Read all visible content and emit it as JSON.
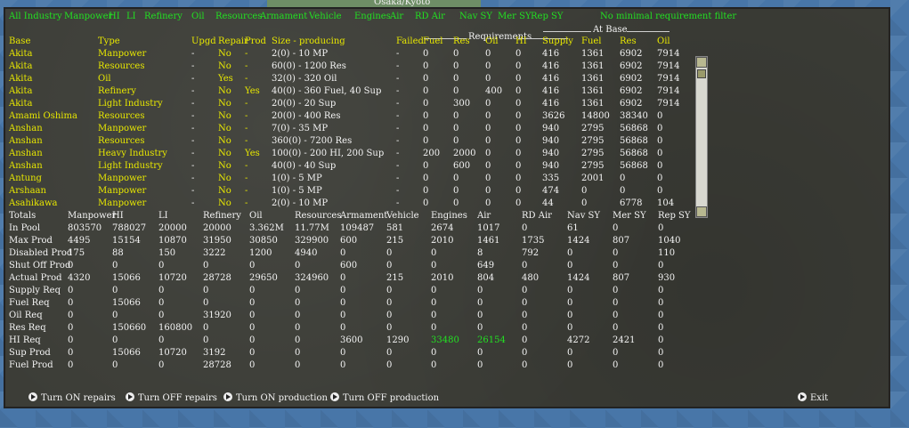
{
  "map": {
    "city": "Osaka/Kyoto"
  },
  "filters": [
    "All Industry",
    "Manpower",
    "HI",
    "LI",
    "Refinery",
    "Oil",
    "Resources",
    "Armament",
    "Vehicle",
    "Engines",
    "Air",
    "RD Air",
    "Nav SY",
    "Mer SY",
    "Rep SY",
    "No minimal requirement filter"
  ],
  "sections": {
    "requirements": "Requirements",
    "at_base": "At Base"
  },
  "columns": [
    "Base",
    "Type",
    "Upgd",
    "Repair",
    "Prod",
    "Size - producing",
    "Failed",
    "Fuel",
    "Res",
    "Oil",
    "HI",
    "Supply",
    "Fuel",
    "Res",
    "Oil"
  ],
  "bases": [
    [
      "Akita",
      "Manpower",
      "-",
      "No",
      "-",
      "2(0) - 10 MP",
      "-",
      "0",
      "0",
      "0",
      "0",
      "416",
      "1361",
      "6902",
      "7914"
    ],
    [
      "Akita",
      "Resources",
      "-",
      "No",
      "-",
      "60(0) - 1200 Res",
      "-",
      "0",
      "0",
      "0",
      "0",
      "416",
      "1361",
      "6902",
      "7914"
    ],
    [
      "Akita",
      "Oil",
      "-",
      "Yes",
      "-",
      "32(0) - 320 Oil",
      "-",
      "0",
      "0",
      "0",
      "0",
      "416",
      "1361",
      "6902",
      "7914"
    ],
    [
      "Akita",
      "Refinery",
      "-",
      "No",
      "Yes",
      "40(0) - 360 Fuel, 40 Sup",
      "-",
      "0",
      "0",
      "400",
      "0",
      "416",
      "1361",
      "6902",
      "7914"
    ],
    [
      "Akita",
      "Light Industry",
      "-",
      "No",
      "-",
      "20(0) - 20 Sup",
      "-",
      "0",
      "300",
      "0",
      "0",
      "416",
      "1361",
      "6902",
      "7914"
    ],
    [
      "Amami Oshima",
      "Resources",
      "-",
      "No",
      "-",
      "20(0) - 400 Res",
      "-",
      "0",
      "0",
      "0",
      "0",
      "3626",
      "14800",
      "38340",
      "0"
    ],
    [
      "Anshan",
      "Manpower",
      "-",
      "No",
      "-",
      "7(0) - 35 MP",
      "-",
      "0",
      "0",
      "0",
      "0",
      "940",
      "2795",
      "56868",
      "0"
    ],
    [
      "Anshan",
      "Resources",
      "-",
      "No",
      "-",
      "360(0) - 7200 Res",
      "-",
      "0",
      "0",
      "0",
      "0",
      "940",
      "2795",
      "56868",
      "0"
    ],
    [
      "Anshan",
      "Heavy Industry",
      "-",
      "No",
      "Yes",
      "100(0) - 200 HI, 200 Sup",
      "-",
      "200",
      "2000",
      "0",
      "0",
      "940",
      "2795",
      "56868",
      "0"
    ],
    [
      "Anshan",
      "Light Industry",
      "-",
      "No",
      "-",
      "40(0) - 40 Sup",
      "-",
      "0",
      "600",
      "0",
      "0",
      "940",
      "2795",
      "56868",
      "0"
    ],
    [
      "Antung",
      "Manpower",
      "-",
      "No",
      "-",
      "1(0) - 5 MP",
      "-",
      "0",
      "0",
      "0",
      "0",
      "335",
      "2001",
      "0",
      "0"
    ],
    [
      "Arshaan",
      "Manpower",
      "-",
      "No",
      "-",
      "1(0) - 5 MP",
      "-",
      "0",
      "0",
      "0",
      "0",
      "474",
      "0",
      "0",
      "0"
    ],
    [
      "Asahikawa",
      "Manpower",
      "-",
      "No",
      "-",
      "2(0) - 10 MP",
      "-",
      "0",
      "0",
      "0",
      "0",
      "44",
      "0",
      "6778",
      "104"
    ]
  ],
  "totals_header": [
    "Totals",
    "Manpower",
    "HI",
    "LI",
    "Refinery",
    "Oil",
    "Resources",
    "Armament",
    "Vehicle",
    "Engines",
    "Air",
    "RD Air",
    "Nav SY",
    "Mer SY",
    "Rep SY"
  ],
  "totals": [
    [
      "In Pool",
      "803570",
      "788027",
      "20000",
      "20000",
      "3.362M",
      "11.77M",
      "109487",
      "581",
      "2674",
      "1017",
      "0",
      "61",
      "0",
      "0"
    ],
    [
      "Max Prod",
      "4495",
      "15154",
      "10870",
      "31950",
      "30850",
      "329900",
      "600",
      "215",
      "2010",
      "1461",
      "1735",
      "1424",
      "807",
      "1040"
    ],
    [
      "Disabled Prod",
      "175",
      "88",
      "150",
      "3222",
      "1200",
      "4940",
      "0",
      "0",
      "0",
      "8",
      "792",
      "0",
      "0",
      "110"
    ],
    [
      "Shut Off Prod",
      "0",
      "0",
      "0",
      "0",
      "0",
      "0",
      "600",
      "0",
      "0",
      "649",
      "0",
      "0",
      "0",
      "0"
    ],
    [
      "Actual Prod",
      "4320",
      "15066",
      "10720",
      "28728",
      "29650",
      "324960",
      "0",
      "215",
      "2010",
      "804",
      "480",
      "1424",
      "807",
      "930"
    ],
    [
      "Supply Req",
      "0",
      "0",
      "0",
      "0",
      "0",
      "0",
      "0",
      "0",
      "0",
      "0",
      "0",
      "0",
      "0",
      "0"
    ],
    [
      "Fuel Req",
      "0",
      "15066",
      "0",
      "0",
      "0",
      "0",
      "0",
      "0",
      "0",
      "0",
      "0",
      "0",
      "0",
      "0"
    ],
    [
      "Oil Req",
      "0",
      "0",
      "0",
      "31920",
      "0",
      "0",
      "0",
      "0",
      "0",
      "0",
      "0",
      "0",
      "0",
      "0"
    ],
    [
      "Res Req",
      "0",
      "150660",
      "160800",
      "0",
      "0",
      "0",
      "0",
      "0",
      "0",
      "0",
      "0",
      "0",
      "0",
      "0"
    ],
    [
      "HI Req",
      "0",
      "0",
      "0",
      "0",
      "0",
      "0",
      "3600",
      "1290",
      "33480",
      "26154",
      "0",
      "4272",
      "2421",
      "0"
    ],
    [
      "Sup Prod",
      "0",
      "15066",
      "10720",
      "3192",
      "0",
      "0",
      "0",
      "0",
      "0",
      "0",
      "0",
      "0",
      "0",
      "0"
    ],
    [
      "Fuel Prod",
      "0",
      "0",
      "0",
      "28728",
      "0",
      "0",
      "0",
      "0",
      "0",
      "0",
      "0",
      "0",
      "0",
      "0"
    ]
  ],
  "actions": [
    "Turn ON repairs",
    "Turn OFF repairs",
    "Turn ON production",
    "Turn OFF production",
    "Exit"
  ],
  "colors": {
    "highlight": "#22e022",
    "base_name": "#e8e800",
    "text": "#f4f4f4"
  }
}
